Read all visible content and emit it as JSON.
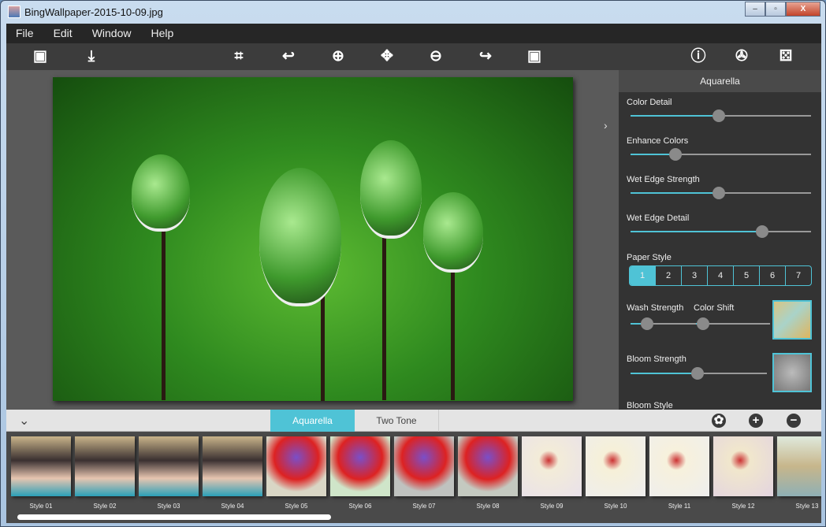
{
  "window": {
    "title": "BingWallpaper-2015-10-09.jpg",
    "minimize": "‒",
    "maximize": "▫",
    "close": "X"
  },
  "menu": [
    "File",
    "Edit",
    "Window",
    "Help"
  ],
  "toolbar": [
    {
      "name": "open-image-icon",
      "glyph": "▣"
    },
    {
      "name": "save-icon",
      "glyph": "⤓"
    },
    {
      "name": "crop-icon",
      "glyph": "⌗"
    },
    {
      "name": "rotate-left-icon",
      "glyph": "↩"
    },
    {
      "name": "zoom-in-icon",
      "glyph": "⊕"
    },
    {
      "name": "move-icon",
      "glyph": "✥"
    },
    {
      "name": "zoom-out-icon",
      "glyph": "⊖"
    },
    {
      "name": "rotate-right-icon",
      "glyph": "↪"
    },
    {
      "name": "fit-image-icon",
      "glyph": "▣"
    },
    {
      "name": "info-icon",
      "glyph": "ⓘ"
    },
    {
      "name": "settings-icon",
      "glyph": "✇"
    },
    {
      "name": "dice-icon",
      "glyph": "⚄"
    }
  ],
  "panel": {
    "title": "Aquarella",
    "expand_icon": "›",
    "sliders": [
      {
        "label": "Color Detail",
        "value": 49
      },
      {
        "label": "Enhance Colors",
        "value": 25
      },
      {
        "label": "Wet Edge Strength",
        "value": 49
      },
      {
        "label": "Wet Edge Detail",
        "value": 73
      }
    ],
    "paper_style": {
      "label": "Paper Style",
      "options": [
        "1",
        "2",
        "3",
        "4",
        "5",
        "6",
        "7"
      ],
      "selected": "1"
    },
    "wash_strength": {
      "label": "Wash Strength",
      "value": 25
    },
    "color_shift": {
      "label": "Color Shift",
      "value": 10
    },
    "bloom_strength": {
      "label": "Bloom Strength",
      "value": 49
    },
    "bloom_style": {
      "label": "Bloom Style"
    }
  },
  "styles_bar": {
    "collapse_icon": "⌄",
    "tabs": [
      "Aquarella",
      "Two Tone"
    ],
    "active_tab": "Aquarella",
    "buttons": [
      {
        "name": "palette-button",
        "glyph": "✿"
      },
      {
        "name": "add-style-button",
        "glyph": "+"
      },
      {
        "name": "remove-style-button",
        "glyph": "−"
      }
    ]
  },
  "thumbnails": [
    "Style 01",
    "Style 02",
    "Style 03",
    "Style 04",
    "Style 05",
    "Style 06",
    "Style 07",
    "Style 08",
    "Style 09",
    "Style 10",
    "Style 11",
    "Style 12",
    "Style 13"
  ],
  "colors": {
    "accent": "#4fc3d6",
    "panel": "#333333",
    "toolbar": "#3c3c3c"
  }
}
